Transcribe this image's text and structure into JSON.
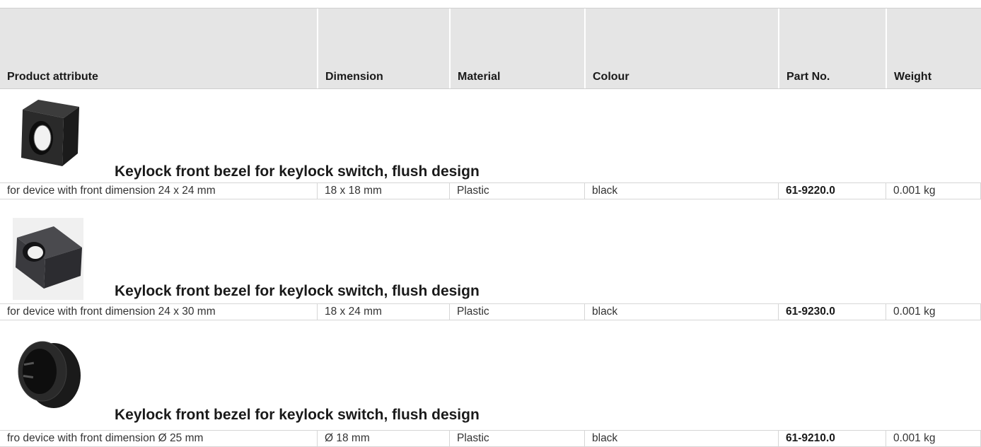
{
  "table": {
    "headers": [
      "Product attribute",
      "Dimension",
      "Material",
      "Colour",
      "Part No.",
      "Weight"
    ],
    "groups": [
      {
        "title": "Keylock front bezel for keylock switch, flush design",
        "image_icon": "square-bezel-icon",
        "row": {
          "attribute": "for device with front dimension 24 x 24 mm",
          "dimension": "18 x 18 mm",
          "material": "Plastic",
          "colour": "black",
          "part_no": "61-9220.0",
          "weight": "0.001 kg"
        }
      },
      {
        "title": "Keylock front bezel for keylock switch, flush design",
        "image_icon": "rectangular-bezel-icon",
        "row": {
          "attribute": "for device with front dimension 24 x 30 mm",
          "dimension": "18 x 24 mm",
          "material": "Plastic",
          "colour": "black",
          "part_no": "61-9230.0",
          "weight": "0.001 kg"
        }
      },
      {
        "title": "Keylock front bezel for keylock switch, flush design",
        "image_icon": "round-bezel-icon",
        "row": {
          "attribute": "fro device with front dimension Ø 25 mm",
          "dimension": "Ø 18 mm",
          "material": "Plastic",
          "colour": "black",
          "part_no": "61-9210.0",
          "weight": "0.001 kg"
        }
      }
    ]
  }
}
